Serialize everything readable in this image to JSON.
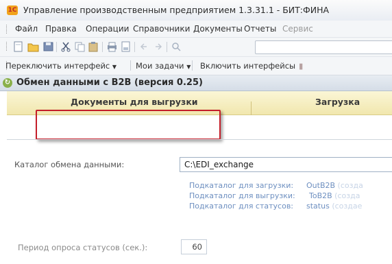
{
  "window": {
    "title": "Управление производственным предприятием 1.3.31.1 - БИТ:ФИНА"
  },
  "menu": {
    "items": [
      "Файл",
      "Правка",
      "Операции",
      "Справочники",
      "Документы",
      "Отчеты",
      "Сервис"
    ]
  },
  "toolbar": {
    "buttons": [
      "new-icon",
      "open-folder-icon",
      "save-icon",
      "cut-icon",
      "copy-icon",
      "paste-icon",
      "print-icon",
      "preview-icon",
      "back-icon",
      "forward-icon",
      "search-icon"
    ]
  },
  "interface_bar": {
    "switch_interface": "Переключить интерфейс",
    "my_tasks": "Мои задачи",
    "enable_interfaces": "Включить интерфейсы"
  },
  "form": {
    "title": "Обмен данными с B2B (версия 0.25)",
    "tabs": [
      "Документы для выгрузки",
      "Загрузка"
    ],
    "active_tab": "Документы для выгрузки",
    "catalog_label": "Каталог обмена данными:",
    "catalog_value": "C:\\EDI_exchange",
    "subcatalogs": [
      {
        "label": "Подкаталог для загрузки:",
        "value": "OutB2B",
        "note": "(созда"
      },
      {
        "label": "Подкаталог для выгрузки:",
        "value": "ToB2B",
        "note": "(созда"
      },
      {
        "label": "Подкаталог для статусов:",
        "value": "status",
        "note": "(создае"
      }
    ],
    "period_label": "Период опроса статусов (сек.):",
    "period_value": "60"
  },
  "colors": {
    "highlight": "#c41e2a",
    "tab_bg": "#f1e7ae",
    "link": "#6d8fc0"
  }
}
